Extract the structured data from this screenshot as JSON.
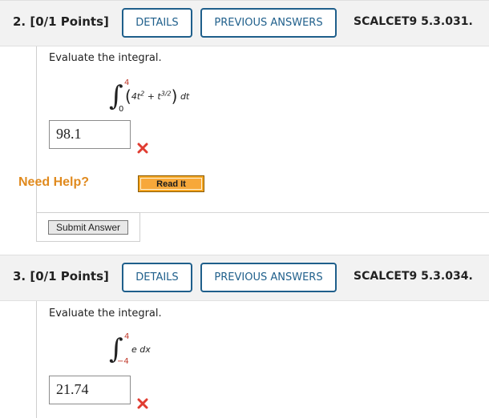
{
  "questions": [
    {
      "number_label": "2.",
      "points_label": "[0/1 Points]",
      "details_label": "DETAILS",
      "previous_answers_label": "PREVIOUS ANSWERS",
      "reference": "SCALCET9 5.3.031.",
      "prompt": "Evaluate the integral.",
      "integral": {
        "upper": "4",
        "lower": "0",
        "integrand_a": "4t",
        "exp_a": "2",
        "plus": " + t",
        "exp_b": "3/2",
        "differential": "dt"
      },
      "answer_value": "98.1",
      "answer_status": "incorrect",
      "need_help_label": "Need Help?",
      "read_it_label": "Read It",
      "submit_label": "Submit Answer"
    },
    {
      "number_label": "3.",
      "points_label": "[0/1 Points]",
      "details_label": "DETAILS",
      "previous_answers_label": "PREVIOUS ANSWERS",
      "reference": "SCALCET9 5.3.034.",
      "prompt": "Evaluate the integral.",
      "integral": {
        "upper": "4",
        "lower": "−4",
        "integrand": "e dx"
      },
      "answer_value": "21.74",
      "answer_status": "incorrect"
    }
  ],
  "colors": {
    "button_border": "#1f5f8b",
    "need_help": "#e08a1e",
    "read_it_bg": "#f5a623",
    "error_x": "#e03c31",
    "header_bg": "#f2f2f2"
  },
  "icons": {
    "incorrect": "x-mark-icon"
  }
}
